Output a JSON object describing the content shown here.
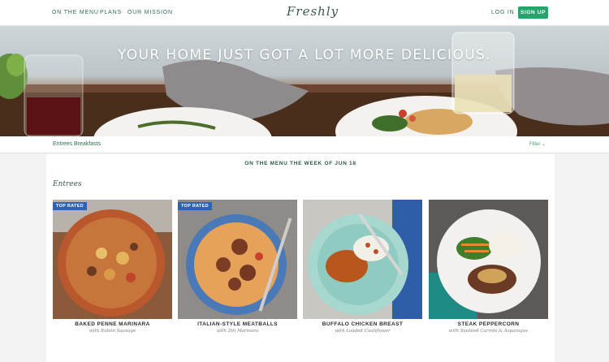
{
  "nav": {
    "links": [
      "ON THE MENU",
      "PLANS",
      "OUR MISSION"
    ],
    "logo": "Freshly",
    "login": "LOG IN",
    "signup": "SIGN UP"
  },
  "hero": {
    "headline": "YOUR HOME JUST GOT A LOT MORE DELICIOUS."
  },
  "filterbar": {
    "tabs": [
      "Entrees",
      "Breakfasts"
    ],
    "filter": "Filter"
  },
  "menu": {
    "week_title": "ON THE MENU THE WEEK OF JUN 18",
    "section_title": "Entrees",
    "meals": [
      {
        "name": "BAKED PENNE MARINARA",
        "sub": "with Italian Sausage",
        "badge": "TOP RATED"
      },
      {
        "name": "ITALIAN-STYLE MEATBALLS",
        "sub": "with Ziti Marinara",
        "badge": "TOP RATED"
      },
      {
        "name": "BUFFALO CHICKEN BREAST",
        "sub": "with Loaded Cauliflower",
        "badge": ""
      },
      {
        "name": "STEAK PEPPERCORN",
        "sub": "with Sautéed Carrots & Asparagus",
        "badge": ""
      }
    ]
  },
  "colors": {
    "brand_green": "#24a56b",
    "link_green": "#2f6e4f",
    "badge_blue": "#2b64b4"
  }
}
